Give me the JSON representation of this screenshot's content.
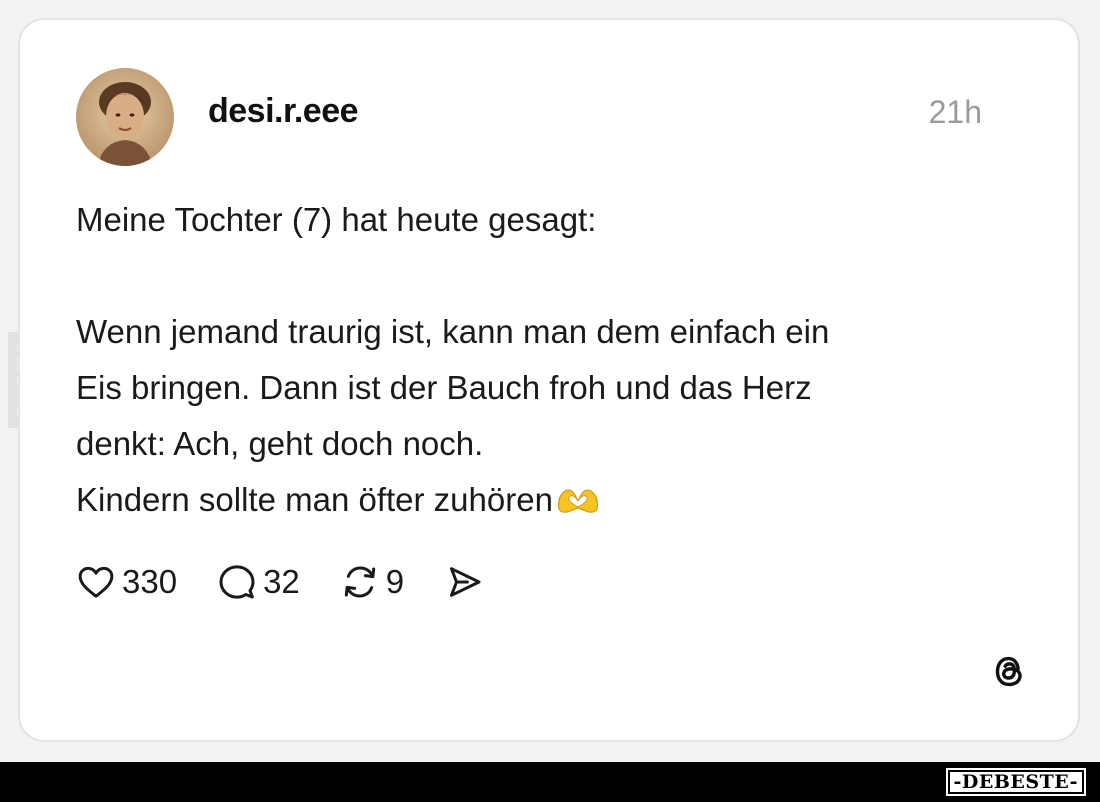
{
  "post": {
    "username": "desi.r.eee",
    "time": "21h",
    "lines": [
      "Meine Tochter (7) hat heute gesagt:",
      "",
      "Wenn jemand traurig ist, kann man dem einfach ein",
      "Eis bringen. Dann ist der Bauch froh und das Herz",
      "denkt: Ach, geht doch noch.",
      "Kindern sollte man öfter zuhören"
    ],
    "emoji": "heart-hands-emoji"
  },
  "actions": {
    "likes": "330",
    "replies": "32",
    "reposts": "9"
  },
  "icons": {
    "like": "heart-icon",
    "reply": "comment-bubble-icon",
    "repost": "repost-icon",
    "share": "send-icon",
    "brand": "threads-logo-icon"
  },
  "watermark": {
    "side": "DEBESTE",
    "bottom": "-DEBESTE-"
  },
  "colors": {
    "background": "#f3f3f3",
    "card": "#ffffff",
    "text": "#1a1a1a",
    "muted": "#9a9a9a",
    "emoji": "#f7c325"
  }
}
